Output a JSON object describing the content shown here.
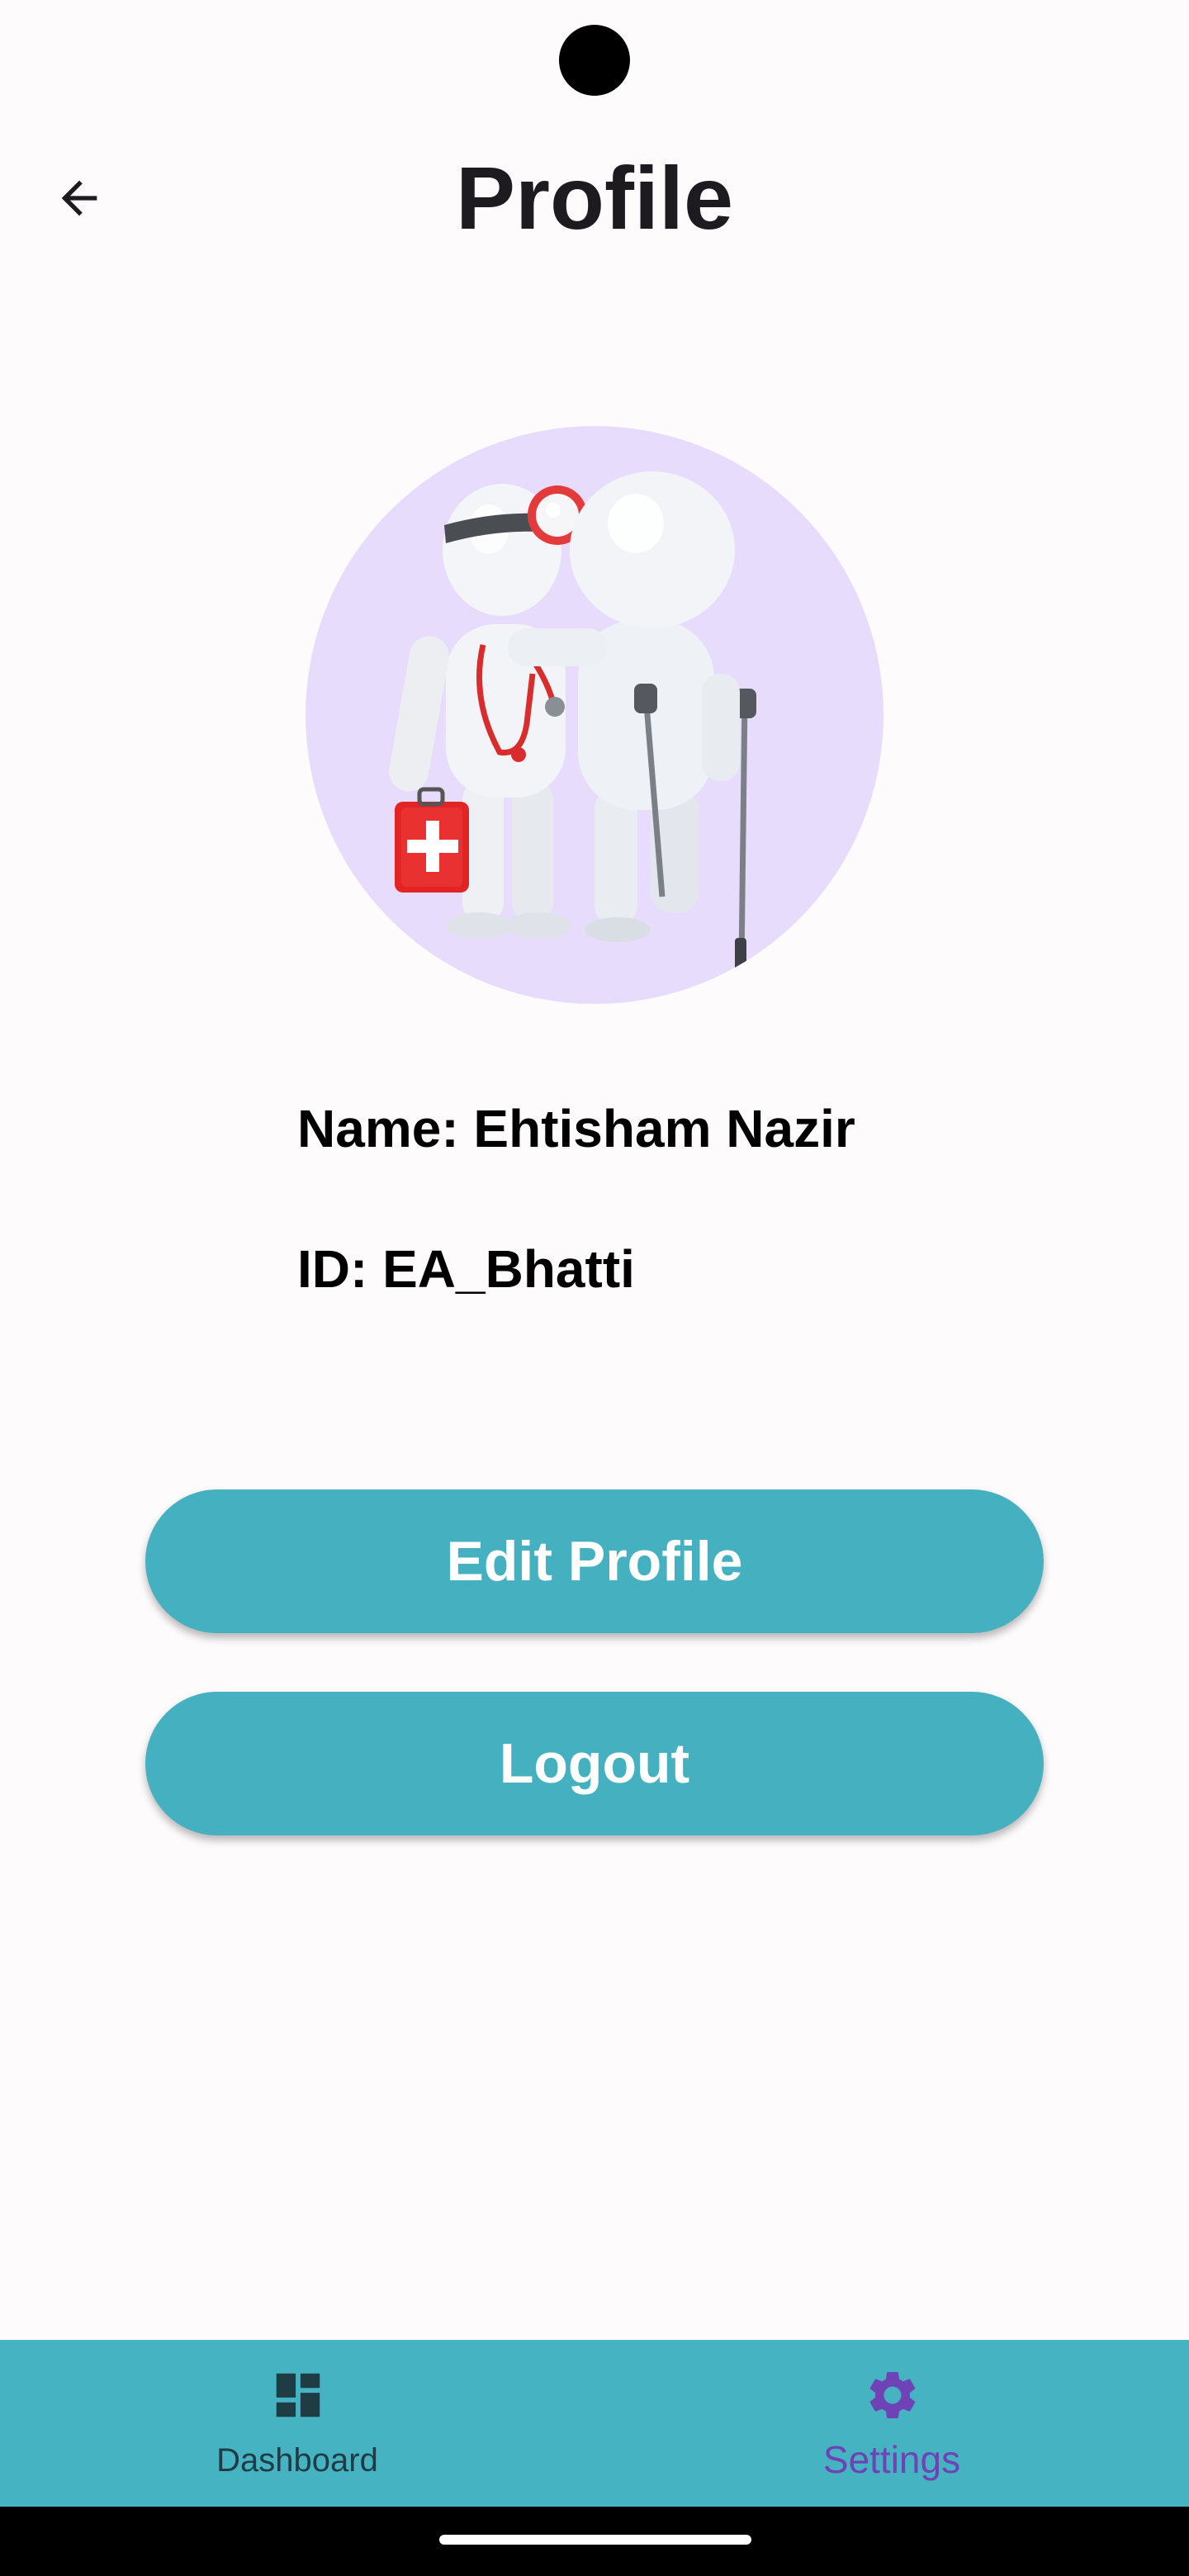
{
  "header": {
    "title": "Profile",
    "back_icon": "arrow-back-icon"
  },
  "profile": {
    "avatar_icon": "doctor-with-patient-illustration",
    "name_line": "Name: Ehtisham Nazir",
    "id_line": "ID: EA_Bhatti"
  },
  "actions": {
    "edit_label": "Edit Profile",
    "logout_label": "Logout"
  },
  "bottom_nav": {
    "items": [
      {
        "label": "Dashboard",
        "icon": "dashboard-icon",
        "selected": false
      },
      {
        "label": "Settings",
        "icon": "gear-icon",
        "selected": true
      }
    ]
  },
  "colors": {
    "background": "#fefbfd",
    "accent": "#45b1c0",
    "avatar_bg": "#e8dcfd",
    "selected_nav": "#6f42b5",
    "unselected_nav": "#1f3c44"
  }
}
